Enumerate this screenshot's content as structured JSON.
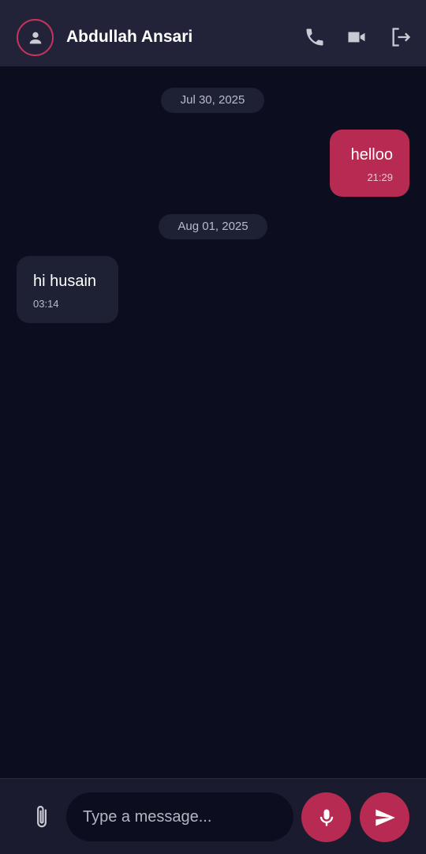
{
  "colors": {
    "background": "#0c0e1f",
    "header": "#222339",
    "accent": "#b72a52",
    "incoming_bubble": "#1e2033",
    "date_chip": "#1e2033",
    "icon": "#c9cad3"
  },
  "header": {
    "avatar_icon": "person-icon",
    "contact_name": "Abdullah Ansari",
    "actions": {
      "call_icon": "phone-icon",
      "video_icon": "video-camera-icon",
      "logout_icon": "logout-icon"
    }
  },
  "conversation": {
    "groups": [
      {
        "date": "Jul 30, 2025",
        "messages": [
          {
            "direction": "outgoing",
            "text": "helloo",
            "time": "21:29"
          }
        ]
      },
      {
        "date": "Aug 01, 2025",
        "messages": [
          {
            "direction": "incoming",
            "text": "hi husain",
            "time": "03:14"
          }
        ]
      }
    ]
  },
  "composer": {
    "attach_icon": "paperclip-icon",
    "input_value": "",
    "input_placeholder": "Type a message...",
    "mic_icon": "microphone-icon",
    "send_icon": "send-icon"
  }
}
